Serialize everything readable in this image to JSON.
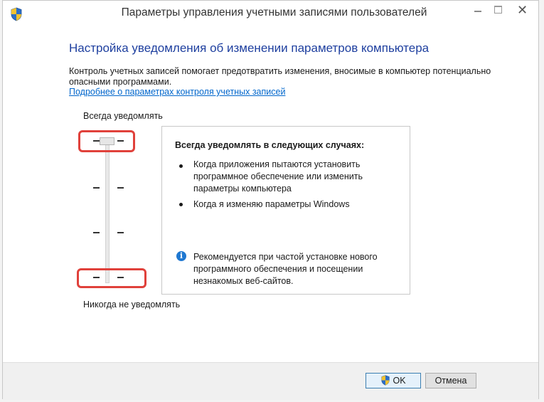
{
  "window": {
    "title": "Параметры управления учетными записями пользователей",
    "icon": "uac-shield-icon",
    "controls": [
      "minimize-icon",
      "maximize-icon",
      "close-icon"
    ],
    "close_glyph": "✕"
  },
  "main": {
    "heading": "Настройка уведомления об изменении параметров компьютера",
    "description": "Контроль учетных записей помогает предотвратить изменения, вносимые в компьютер потенциально опасными программами.",
    "link": "Подробнее о параметрах контроля учетных записей"
  },
  "slider": {
    "top_label": "Всегда уведомлять",
    "bottom_label": "Никогда не уведомлять",
    "levels": 4,
    "selected_level": 4,
    "highlight_color": "#e0413b"
  },
  "info": {
    "title": "Всегда уведомлять в следующих случаях:",
    "bullets": [
      "Когда приложения пытаются установить программное обеспечение или изменить параметры компьютера",
      "Когда я изменяю параметры Windows"
    ],
    "recommendation_icon": "info-icon",
    "recommendation_glyph": "i",
    "recommendation": "Рекомендуется при частой установке нового программного обеспечения и посещении незнакомых веб-сайтов."
  },
  "footer": {
    "ok_label": "OK",
    "cancel_label": "Отмена"
  },
  "colors": {
    "heading": "#1e3f9f",
    "link": "#0066cc",
    "info_icon": "#1f78d1"
  }
}
